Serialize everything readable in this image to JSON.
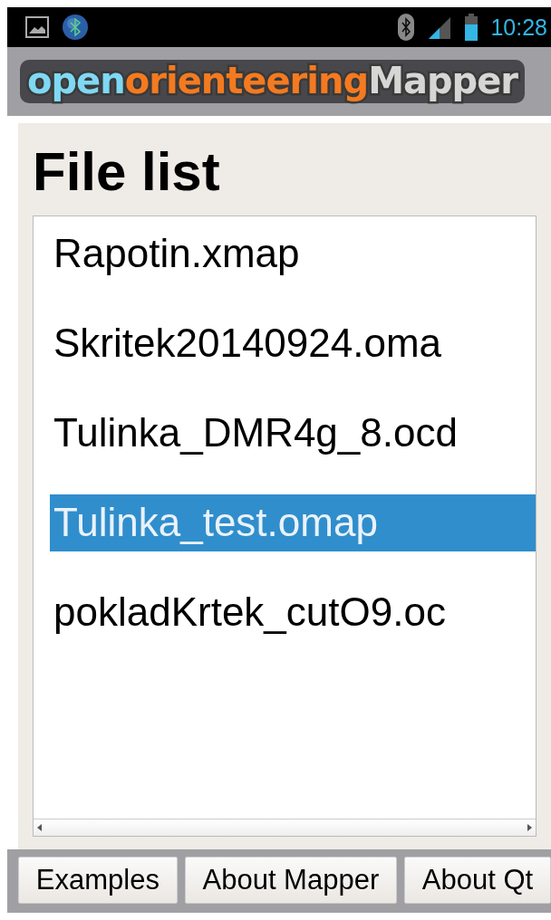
{
  "status_bar": {
    "time": "10:28"
  },
  "logo": [
    {
      "text": "open",
      "color": "#7fd8f4"
    },
    {
      "text": "orienteering",
      "color": "#f47a20"
    },
    {
      "text": "Mapper",
      "color": "#d6d6d4"
    }
  ],
  "title": "File list",
  "files": [
    {
      "name": "Rapotin.xmap",
      "selected": false
    },
    {
      "name": "Skritek20140924.oma",
      "selected": false
    },
    {
      "name": "Tulinka_DMR4g_8.ocd",
      "selected": false
    },
    {
      "name": "Tulinka_test.omap",
      "selected": true
    },
    {
      "name": "pokladKrtek_cutO9.oc",
      "selected": false
    }
  ],
  "buttons": [
    "Examples",
    "About Mapper",
    "About Qt"
  ]
}
